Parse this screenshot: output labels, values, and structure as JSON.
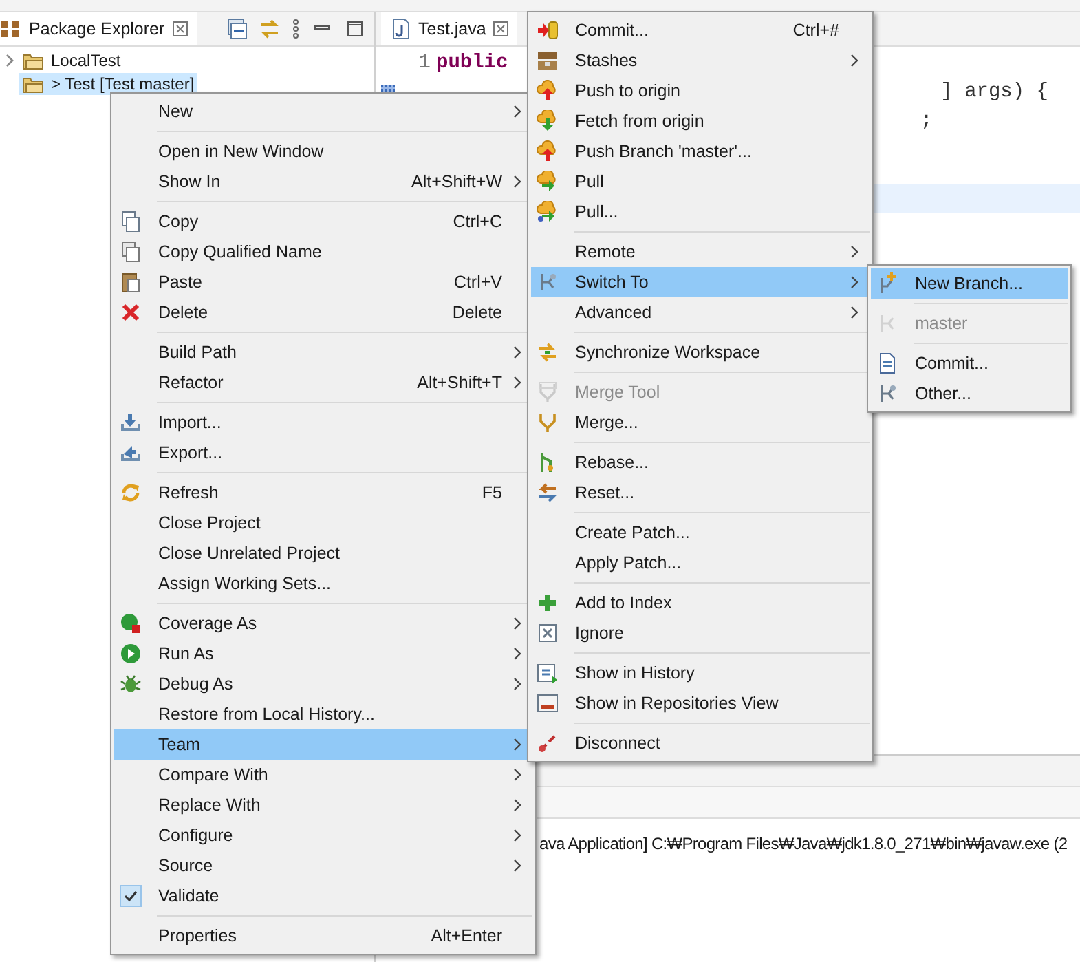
{
  "package_explorer": {
    "tab": "Package Explorer",
    "tree": [
      {
        "label": "LocalTest",
        "selected": false,
        "expandable": true
      },
      {
        "label": "> Test [Test master]",
        "selected": true,
        "expandable": false
      }
    ]
  },
  "editor": {
    "tab": "Test.java",
    "lines": [
      {
        "number": "1",
        "code": "public"
      },
      {
        "trailing": "] args) {"
      },
      {
        "trailing": ";"
      }
    ]
  },
  "console": {
    "text": "ava Application] C:₩Program Files₩Java₩jdk1.8.0_271₩bin₩javaw.exe  (2"
  },
  "context_menu": {
    "items": [
      {
        "kind": "item",
        "label": "New",
        "submenu": true,
        "selected": false
      },
      {
        "kind": "separator"
      },
      {
        "kind": "item",
        "label": "Open in New Window",
        "submenu": false,
        "selected": false
      },
      {
        "kind": "item",
        "label": "Show In",
        "shortcut": "Alt+Shift+W",
        "submenu": true,
        "selected": false
      },
      {
        "kind": "separator"
      },
      {
        "kind": "item",
        "label": "Copy",
        "shortcut": "Ctrl+C",
        "submenu": false,
        "selected": false
      },
      {
        "kind": "item",
        "label": "Copy Qualified Name",
        "submenu": false,
        "selected": false
      },
      {
        "kind": "item",
        "label": "Paste",
        "shortcut": "Ctrl+V",
        "submenu": false,
        "selected": false
      },
      {
        "kind": "item",
        "label": "Delete",
        "shortcut": "Delete",
        "submenu": false,
        "selected": false
      },
      {
        "kind": "separator"
      },
      {
        "kind": "item",
        "label": "Build Path",
        "submenu": true,
        "selected": false
      },
      {
        "kind": "item",
        "label": "Refactor",
        "shortcut": "Alt+Shift+T",
        "submenu": true,
        "selected": false
      },
      {
        "kind": "separator"
      },
      {
        "kind": "item",
        "label": "Import...",
        "submenu": false,
        "selected": false
      },
      {
        "kind": "item",
        "label": "Export...",
        "submenu": false,
        "selected": false
      },
      {
        "kind": "separator"
      },
      {
        "kind": "item",
        "label": "Refresh",
        "shortcut": "F5",
        "submenu": false,
        "selected": false
      },
      {
        "kind": "item",
        "label": "Close Project",
        "submenu": false,
        "selected": false
      },
      {
        "kind": "item",
        "label": "Close Unrelated Project",
        "submenu": false,
        "selected": false
      },
      {
        "kind": "item",
        "label": "Assign Working Sets...",
        "submenu": false,
        "selected": false
      },
      {
        "kind": "separator"
      },
      {
        "kind": "item",
        "label": "Coverage As",
        "submenu": true,
        "selected": false
      },
      {
        "kind": "item",
        "label": "Run As",
        "submenu": true,
        "selected": false
      },
      {
        "kind": "item",
        "label": "Debug As",
        "submenu": true,
        "selected": false
      },
      {
        "kind": "item",
        "label": "Restore from Local History...",
        "submenu": false,
        "selected": false
      },
      {
        "kind": "item",
        "label": "Team",
        "submenu": true,
        "selected": true
      },
      {
        "kind": "item",
        "label": "Compare With",
        "submenu": true,
        "selected": false
      },
      {
        "kind": "item",
        "label": "Replace With",
        "submenu": true,
        "selected": false
      },
      {
        "kind": "item",
        "label": "Configure",
        "submenu": true,
        "selected": false
      },
      {
        "kind": "item",
        "label": "Source",
        "submenu": true,
        "selected": false
      },
      {
        "kind": "check",
        "label": "Validate",
        "checked": true,
        "submenu": false,
        "selected": false
      },
      {
        "kind": "separator"
      },
      {
        "kind": "item",
        "label": "Properties",
        "shortcut": "Alt+Enter",
        "submenu": false,
        "selected": false
      }
    ]
  },
  "team_menu": {
    "items": [
      {
        "kind": "item",
        "label": "Commit...",
        "shortcut": "Ctrl+#",
        "submenu": false,
        "selected": false,
        "disabled": false
      },
      {
        "kind": "item",
        "label": "Stashes",
        "submenu": true,
        "selected": false,
        "disabled": false
      },
      {
        "kind": "item",
        "label": "Push to origin",
        "submenu": false,
        "selected": false,
        "disabled": false
      },
      {
        "kind": "item",
        "label": "Fetch from origin",
        "submenu": false,
        "selected": false,
        "disabled": false
      },
      {
        "kind": "item",
        "label": "Push Branch 'master'...",
        "submenu": false,
        "selected": false,
        "disabled": false
      },
      {
        "kind": "item",
        "label": "Pull",
        "submenu": false,
        "selected": false,
        "disabled": false
      },
      {
        "kind": "item",
        "label": "Pull...",
        "submenu": false,
        "selected": false,
        "disabled": false
      },
      {
        "kind": "separator"
      },
      {
        "kind": "item",
        "label": "Remote",
        "submenu": true,
        "selected": false,
        "disabled": false
      },
      {
        "kind": "item",
        "label": "Switch To",
        "submenu": true,
        "selected": true,
        "disabled": false
      },
      {
        "kind": "item",
        "label": "Advanced",
        "submenu": true,
        "selected": false,
        "disabled": false
      },
      {
        "kind": "separator"
      },
      {
        "kind": "item",
        "label": "Synchronize Workspace",
        "submenu": false,
        "selected": false,
        "disabled": false
      },
      {
        "kind": "separator"
      },
      {
        "kind": "item",
        "label": "Merge Tool",
        "submenu": false,
        "selected": false,
        "disabled": true
      },
      {
        "kind": "item",
        "label": "Merge...",
        "submenu": false,
        "selected": false,
        "disabled": false
      },
      {
        "kind": "separator"
      },
      {
        "kind": "item",
        "label": "Rebase...",
        "submenu": false,
        "selected": false,
        "disabled": false
      },
      {
        "kind": "item",
        "label": "Reset...",
        "submenu": false,
        "selected": false,
        "disabled": false
      },
      {
        "kind": "separator"
      },
      {
        "kind": "item",
        "label": "Create Patch...",
        "submenu": false,
        "selected": false,
        "disabled": false
      },
      {
        "kind": "item",
        "label": "Apply Patch...",
        "submenu": false,
        "selected": false,
        "disabled": false
      },
      {
        "kind": "separator"
      },
      {
        "kind": "item",
        "label": "Add to Index",
        "submenu": false,
        "selected": false,
        "disabled": false
      },
      {
        "kind": "item",
        "label": "Ignore",
        "submenu": false,
        "selected": false,
        "disabled": false
      },
      {
        "kind": "separator"
      },
      {
        "kind": "item",
        "label": "Show in History",
        "submenu": false,
        "selected": false,
        "disabled": false
      },
      {
        "kind": "item",
        "label": "Show in Repositories View",
        "submenu": false,
        "selected": false,
        "disabled": false
      },
      {
        "kind": "separator"
      },
      {
        "kind": "item",
        "label": "Disconnect",
        "submenu": false,
        "selected": false,
        "disabled": false
      }
    ]
  },
  "switch_to_menu": {
    "items": [
      {
        "kind": "item",
        "label": "New Branch...",
        "submenu": false,
        "selected": true,
        "disabled": false
      },
      {
        "kind": "separator"
      },
      {
        "kind": "item",
        "label": "master",
        "submenu": false,
        "selected": false,
        "disabled": true
      },
      {
        "kind": "separator"
      },
      {
        "kind": "item",
        "label": "Commit...",
        "submenu": false,
        "selected": false,
        "disabled": false
      },
      {
        "kind": "item",
        "label": "Other...",
        "submenu": false,
        "selected": false,
        "disabled": false
      }
    ]
  }
}
